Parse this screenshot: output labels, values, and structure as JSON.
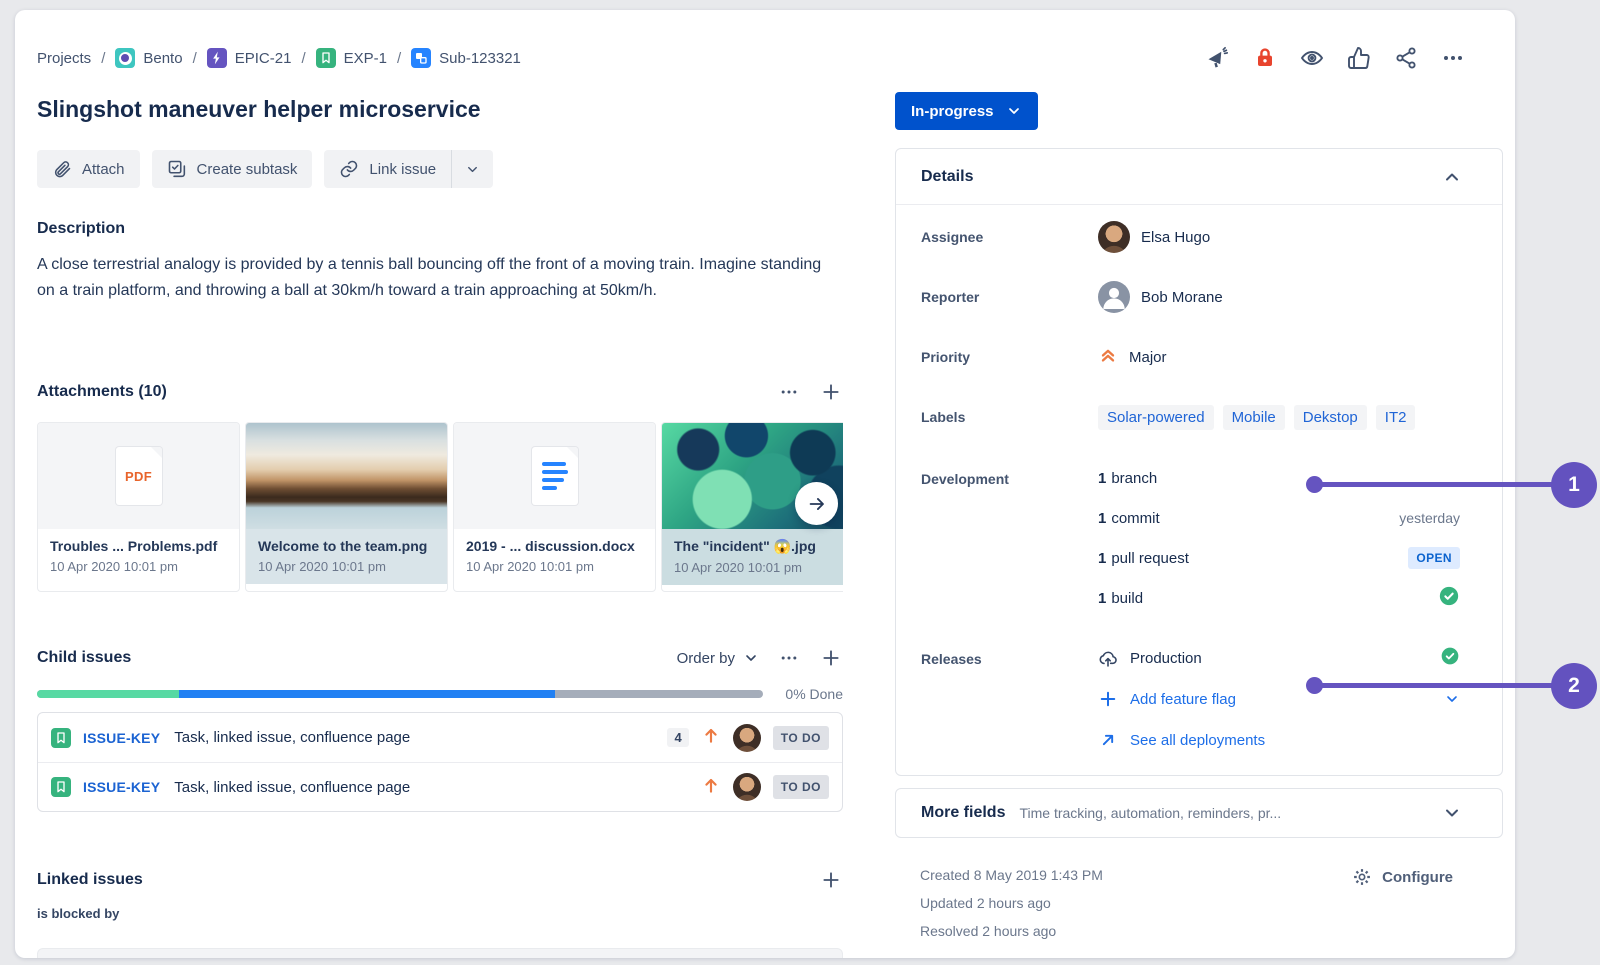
{
  "breadcrumb": {
    "separator": "/",
    "items": [
      {
        "label": "Projects"
      },
      {
        "label": "Bento"
      },
      {
        "label": "EPIC-21"
      },
      {
        "label": "EXP-1"
      },
      {
        "label": "Sub-123321"
      }
    ]
  },
  "top_actions": {
    "icons": [
      "megaphone",
      "lock",
      "eye",
      "thumbs-up",
      "share",
      "more"
    ]
  },
  "header": {
    "title": "Slingshot maneuver helper microservice"
  },
  "toolbar": {
    "attach": "Attach",
    "create_subtask": "Create subtask",
    "link_issue": "Link issue"
  },
  "description": {
    "heading": "Description",
    "body": "A close terrestrial analogy is provided by a tennis ball bouncing off the front of a moving train. Imagine standing on a train platform, and throwing a ball at 30km/h toward a train approaching at 50km/h."
  },
  "attachments": {
    "heading": "Attachments (10)",
    "items": [
      {
        "name": "Troubles ... Problems.pdf",
        "date": "10 Apr 2020 10:01 pm",
        "kind": "pdf",
        "badge": "PDF"
      },
      {
        "name": "Welcome to the team.png",
        "date": "10 Apr 2020 10:01 pm",
        "kind": "photo"
      },
      {
        "name": "2019 - ... discussion.docx",
        "date": "10 Apr 2020 10:01 pm",
        "kind": "doc"
      },
      {
        "name": "The \"incident\" 😱.jpg",
        "date": "10 Apr 2020 10:01 pm",
        "kind": "photo"
      }
    ]
  },
  "child_issues": {
    "heading": "Child issues",
    "order_by": "Order by",
    "done_label": "0% Done",
    "progress": {
      "green_pct": 19.6,
      "blue_pct": 51.8,
      "gray_pct": 28.6
    },
    "rows": [
      {
        "key": "ISSUE-KEY",
        "title": "Task, linked issue, confluence page",
        "count": "4",
        "status": "TO DO"
      },
      {
        "key": "ISSUE-KEY",
        "title": "Task, linked issue, confluence page",
        "status": "TO DO"
      }
    ]
  },
  "linked_issues": {
    "heading": "Linked issues",
    "relation": "is blocked by"
  },
  "status": {
    "label": "In-progress"
  },
  "details": {
    "heading": "Details",
    "assignee_label": "Assignee",
    "assignee": "Elsa Hugo",
    "reporter_label": "Reporter",
    "reporter": "Bob Morane",
    "priority_label": "Priority",
    "priority": "Major",
    "labels_label": "Labels",
    "labels": [
      "Solar-powered",
      "Mobile",
      "Dekstop",
      "IT2"
    ],
    "development_label": "Development",
    "development": [
      {
        "count": "1",
        "name": "branch"
      },
      {
        "count": "1",
        "name": "commit",
        "meta": "yesterday"
      },
      {
        "count": "1",
        "name": "pull request",
        "badge": "OPEN"
      },
      {
        "count": "1",
        "name": "build",
        "check": true
      }
    ],
    "releases_label": "Releases",
    "release_name": "Production",
    "add_feature_flag": "Add feature flag",
    "see_all_deployments": "See all deployments"
  },
  "more_fields": {
    "heading": "More fields",
    "summary": "Time tracking, automation, reminders, pr..."
  },
  "footer": {
    "created": "Created 8 May 2019 1:43 PM",
    "updated": "Updated 2 hours ago",
    "resolved": "Resolved 2 hours ago",
    "configure": "Configure"
  },
  "callouts": [
    {
      "number": "1"
    },
    {
      "number": "2"
    }
  ],
  "colors": {
    "status_bg": "#0052CC",
    "callout": "#6554C0",
    "success": "#36B37E",
    "priority": "#EC7A42",
    "lock": "#E8442E",
    "link": "#1D6EE8",
    "progress_green": "#57D9A3",
    "progress_blue": "#2180F3",
    "progress_gray": "#A5ADBA"
  }
}
